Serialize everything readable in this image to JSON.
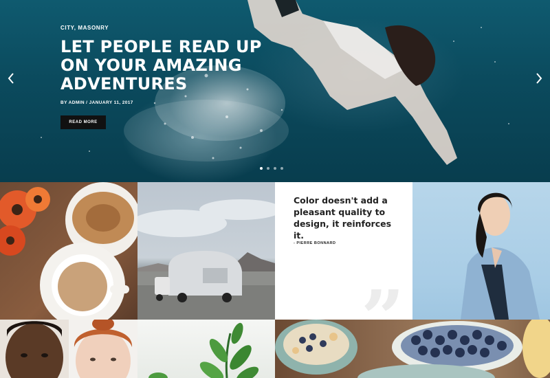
{
  "hero": {
    "category": "CITY, MASONRY",
    "title_lines": [
      "LET PEOPLE READ UP",
      "ON YOUR AMAZING",
      "ADVENTURES"
    ],
    "meta": "BY ADMIN / JANUARY 11, 2017",
    "button_label": "READ MORE",
    "slide_count": 4,
    "active_slide": 1
  },
  "quote": {
    "text": "Color doesn't add a pleasant quality to design, it reinforces it.",
    "author": "- PIERRE BONNARD"
  },
  "icons": {
    "prev": "chevron-left-icon",
    "next": "chevron-right-icon",
    "quote": "quote-mark-icon"
  },
  "colors": {
    "hero_water": "#0b4a5d",
    "button_bg": "#111111",
    "quote_text": "#222222"
  }
}
